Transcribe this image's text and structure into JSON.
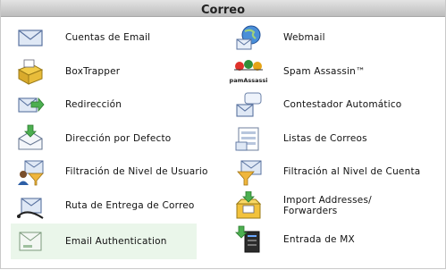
{
  "panel": {
    "title": "Correo"
  },
  "items": [
    {
      "label": "Cuentas de Email",
      "icon": "envelope-icon"
    },
    {
      "label": "Webmail",
      "icon": "globe-mail-icon"
    },
    {
      "label": "BoxTrapper",
      "icon": "boxtrapper-icon"
    },
    {
      "label": "Spam Assassin™",
      "icon": "spamassassin-icon",
      "logo_text": "SpamAssassin"
    },
    {
      "label": "Redirección",
      "icon": "forward-arrow-icon"
    },
    {
      "label": "Contestador Automático",
      "icon": "autoresponder-icon"
    },
    {
      "label": "Dirección por Defecto",
      "icon": "default-address-icon"
    },
    {
      "label": "Listas de Correos",
      "icon": "mailing-list-icon"
    },
    {
      "label": "Filtración de Nivel de Usuario",
      "icon": "user-filter-icon"
    },
    {
      "label": "Filtración al Nivel de Cuenta",
      "icon": "account-filter-icon"
    },
    {
      "label": "Ruta de Entrega de Correo",
      "icon": "delivery-route-icon"
    },
    {
      "label": "Import Addresses/\nForwarders",
      "icon": "import-box-icon"
    },
    {
      "label": "Email Authentication",
      "icon": "email-auth-icon"
    },
    {
      "label": "Entrada de MX",
      "icon": "mx-server-icon"
    }
  ]
}
